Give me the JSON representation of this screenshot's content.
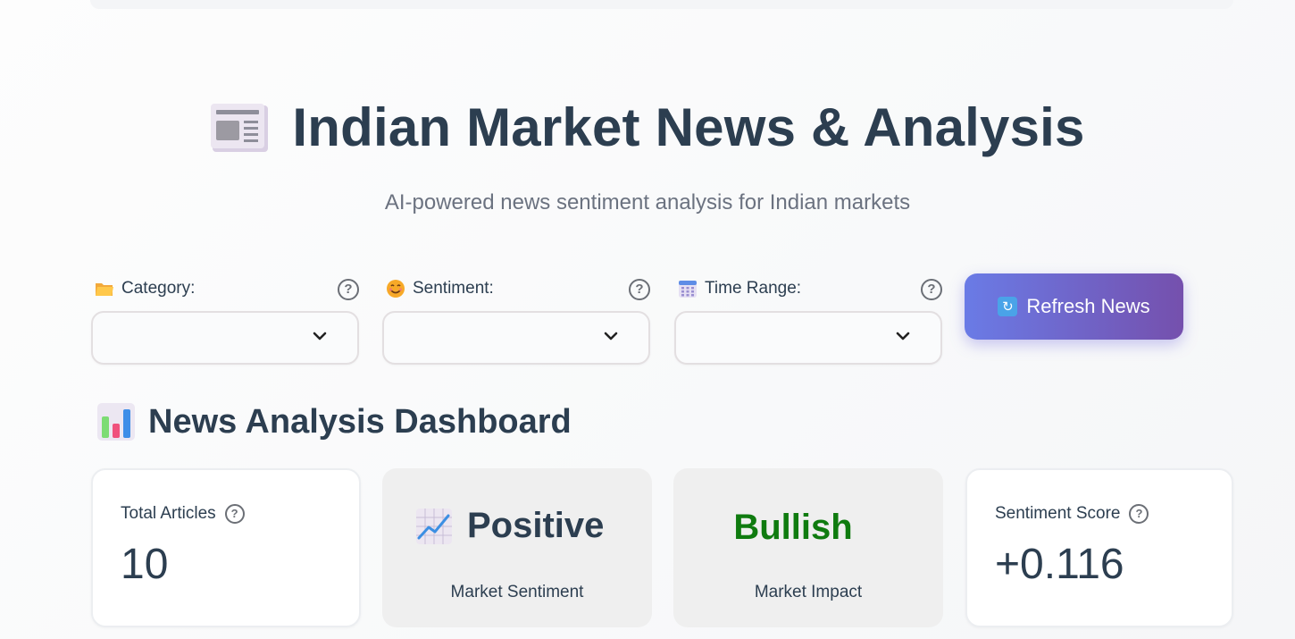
{
  "hero": {
    "title": "Indian Market News & Analysis",
    "subtitle": "AI-powered news sentiment analysis for Indian markets",
    "icon": "newspaper-icon"
  },
  "filters": [
    {
      "label": "Category:",
      "icon": "folder-icon",
      "value": ""
    },
    {
      "label": "Sentiment:",
      "icon": "smiley-icon",
      "value": ""
    },
    {
      "label": "Time Range:",
      "icon": "calendar-icon",
      "value": ""
    }
  ],
  "refresh": {
    "label": "Refresh News",
    "icon": "refresh-icon"
  },
  "dashboard": {
    "title": "News Analysis Dashboard",
    "icon": "bar-chart-icon"
  },
  "metrics": {
    "total_articles": {
      "label": "Total Articles",
      "value": "10"
    },
    "market_sentiment": {
      "value": "Positive",
      "caption": "Market Sentiment",
      "icon": "chart-increasing-icon"
    },
    "market_impact": {
      "value": "Bullish",
      "caption": "Market Impact",
      "color": "#0f7b0f"
    },
    "sentiment_score": {
      "label": "Sentiment Score",
      "value": "+0.116"
    }
  },
  "help_glyph": "?",
  "colors": {
    "heading": "#2c3e50",
    "button_start": "#6a7be6",
    "button_end": "#7550ad",
    "bullish": "#0f7b0f"
  }
}
